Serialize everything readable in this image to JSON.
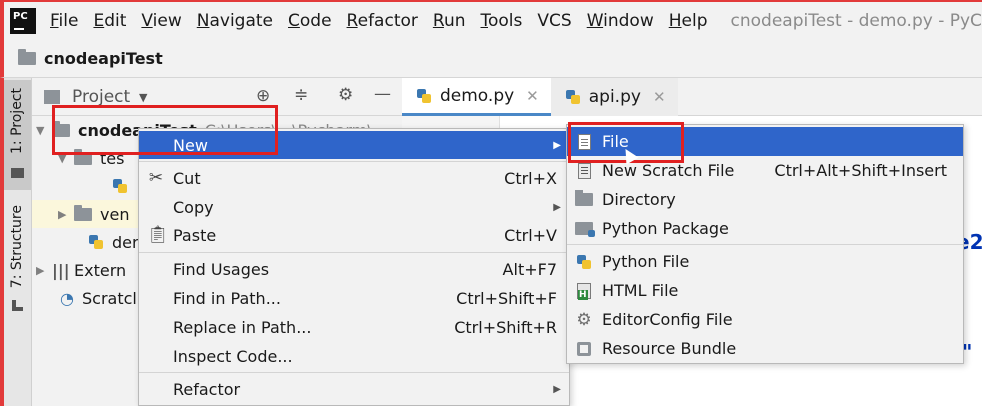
{
  "menubar": {
    "items": [
      {
        "label": "File",
        "mnemonic": "F",
        "rest": "ile"
      },
      {
        "label": "Edit",
        "mnemonic": "E",
        "rest": "dit"
      },
      {
        "label": "View",
        "mnemonic": "V",
        "rest": "iew"
      },
      {
        "label": "Navigate",
        "mnemonic": "N",
        "rest": "avigate"
      },
      {
        "label": "Code",
        "mnemonic": "C",
        "rest": "ode"
      },
      {
        "label": "Refactor",
        "mnemonic": "R",
        "rest": "efactor"
      },
      {
        "label": "Run",
        "mnemonic": "R",
        "rest": "un"
      },
      {
        "label": "Tools",
        "mnemonic": "T",
        "rest": "ools"
      },
      {
        "label": "VCS",
        "mnemonic": "",
        "rest": "VCS"
      },
      {
        "label": "Window",
        "mnemonic": "W",
        "rest": "indow"
      },
      {
        "label": "Help",
        "mnemonic": "H",
        "rest": "elp"
      }
    ],
    "window_title": "cnodeapiTest - demo.py - PyC",
    "logo_text": "PC"
  },
  "breadcrumb": {
    "project": "cnodeapiTest"
  },
  "left_strip": {
    "project_tab": "1: Project",
    "structure_tab": "7: Structure"
  },
  "project_panel": {
    "title": "Project",
    "dropdown_arrow": "▼"
  },
  "editor_tabs": [
    {
      "label": "demo.py",
      "active": true
    },
    {
      "label": "api.py",
      "active": false
    }
  ],
  "tree": {
    "root_label": "cnodeapiTest",
    "root_path": "C:\\Users\\...\\Pycharm\\",
    "child_test": "tes",
    "child_venv": "ven",
    "child_demo": "der",
    "external": "Extern",
    "scratches": "Scratcl"
  },
  "editor_fragments": {
    "frag1": "e2",
    "frag2": "\""
  },
  "context_menu": {
    "items": [
      {
        "label": "New",
        "shortcut": "",
        "submenu": true
      },
      {
        "label": "Cut",
        "shortcut": "Ctrl+X",
        "submenu": false
      },
      {
        "label": "Copy",
        "shortcut": "",
        "submenu": true
      },
      {
        "label": "Paste",
        "shortcut": "Ctrl+V",
        "submenu": false
      },
      {
        "label": "Find Usages",
        "shortcut": "Alt+F7",
        "submenu": false
      },
      {
        "label": "Find in Path...",
        "shortcut": "Ctrl+Shift+F",
        "submenu": false
      },
      {
        "label": "Replace in Path...",
        "shortcut": "Ctrl+Shift+R",
        "submenu": false
      },
      {
        "label": "Inspect Code...",
        "shortcut": "",
        "submenu": false
      },
      {
        "label": "Refactor",
        "shortcut": "",
        "submenu": true
      }
    ]
  },
  "new_submenu": {
    "items": [
      {
        "label": "File",
        "shortcut": ""
      },
      {
        "label": "New Scratch File",
        "shortcut": "Ctrl+Alt+Shift+Insert"
      },
      {
        "label": "Directory",
        "shortcut": ""
      },
      {
        "label": "Python Package",
        "shortcut": ""
      },
      {
        "label": "Python File",
        "shortcut": ""
      },
      {
        "label": "HTML File",
        "shortcut": ""
      },
      {
        "label": "EditorConfig File",
        "shortcut": ""
      },
      {
        "label": "Resource Bundle",
        "shortcut": ""
      }
    ]
  },
  "colors": {
    "selection": "#2f65ca",
    "highlight_box": "#e02020",
    "accent_tab": "#4a88c7"
  }
}
